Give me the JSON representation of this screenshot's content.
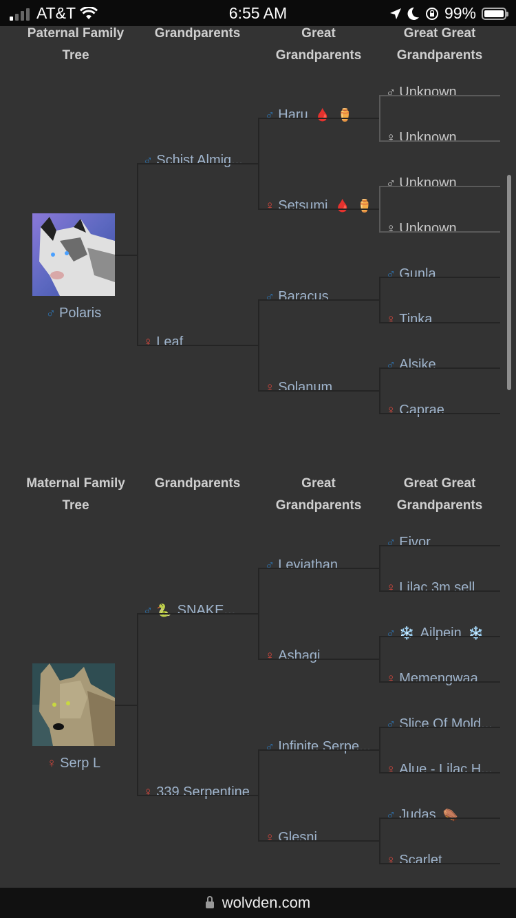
{
  "status_bar": {
    "carrier": "AT&T",
    "time": "6:55 AM",
    "battery": "99%",
    "icons": [
      "signal-icon",
      "wifi-icon",
      "location-icon",
      "moon-icon",
      "rotation-lock-icon",
      "battery-icon"
    ]
  },
  "paternal": {
    "headers": [
      "Paternal Family Tree",
      "Grandparents",
      "Great Grandparents",
      "Great Great Grandparents"
    ],
    "subject": {
      "name": "Polaris",
      "sex": "male"
    },
    "grandparents": [
      {
        "name": "Schist Almig...",
        "sex": "male"
      },
      {
        "name": "Leaf",
        "sex": "female"
      }
    ],
    "great_grandparents": [
      {
        "name": "Haru",
        "sex": "male",
        "badges": [
          "blood-drop-icon",
          "urn-icon"
        ]
      },
      {
        "name": "Setsumi",
        "sex": "female",
        "badges": [
          "blood-drop-icon",
          "urn-icon"
        ]
      },
      {
        "name": "Baracus",
        "sex": "male"
      },
      {
        "name": "Solanum",
        "sex": "female"
      }
    ],
    "great_great_grandparents": [
      {
        "name": "Unknown",
        "sex": "male",
        "unknown": true
      },
      {
        "name": "Unknown",
        "sex": "female",
        "unknown": true
      },
      {
        "name": "Unknown",
        "sex": "male",
        "unknown": true
      },
      {
        "name": "Unknown",
        "sex": "female",
        "unknown": true
      },
      {
        "name": "Gunla",
        "sex": "male"
      },
      {
        "name": "Tinka",
        "sex": "female"
      },
      {
        "name": "Alsike",
        "sex": "male"
      },
      {
        "name": "Caprae",
        "sex": "female"
      }
    ]
  },
  "maternal": {
    "headers": [
      "Maternal Family Tree",
      "Grandparents",
      "Great Grandparents",
      "Great Great Grandparents"
    ],
    "subject": {
      "name": "Serp L",
      "sex": "female"
    },
    "grandparents": [
      {
        "name": "SNAKE...",
        "sex": "male",
        "prefix": "snake-icon"
      },
      {
        "name": "339 Serpentine",
        "sex": "female"
      }
    ],
    "great_grandparents": [
      {
        "name": "Leviathan",
        "sex": "male"
      },
      {
        "name": "Ashagi",
        "sex": "female"
      },
      {
        "name": "Infinite Serpe...",
        "sex": "male"
      },
      {
        "name": "Glesni",
        "sex": "female"
      }
    ],
    "great_great_grandparents": [
      {
        "name": "Eivor",
        "sex": "male"
      },
      {
        "name": "Lilac 3m sell",
        "sex": "female"
      },
      {
        "name": "Ailpein",
        "sex": "male",
        "prefix": "snowflake-icon",
        "badges": [
          "snowflake-icon"
        ]
      },
      {
        "name": "Memengwaa",
        "sex": "female"
      },
      {
        "name": "Slice Of Mold...",
        "sex": "male"
      },
      {
        "name": "Alue - Lilac H...",
        "sex": "female"
      },
      {
        "name": "Judas",
        "sex": "male",
        "badges": [
          "coffin-icon"
        ]
      },
      {
        "name": "Scarlet",
        "sex": "female"
      }
    ]
  },
  "url_bar": {
    "domain": "wolvden.com"
  },
  "colors": {
    "male": "#2e73b0",
    "female": "#d0463c",
    "name_text": "#9fb4cc",
    "background": "#333333"
  }
}
